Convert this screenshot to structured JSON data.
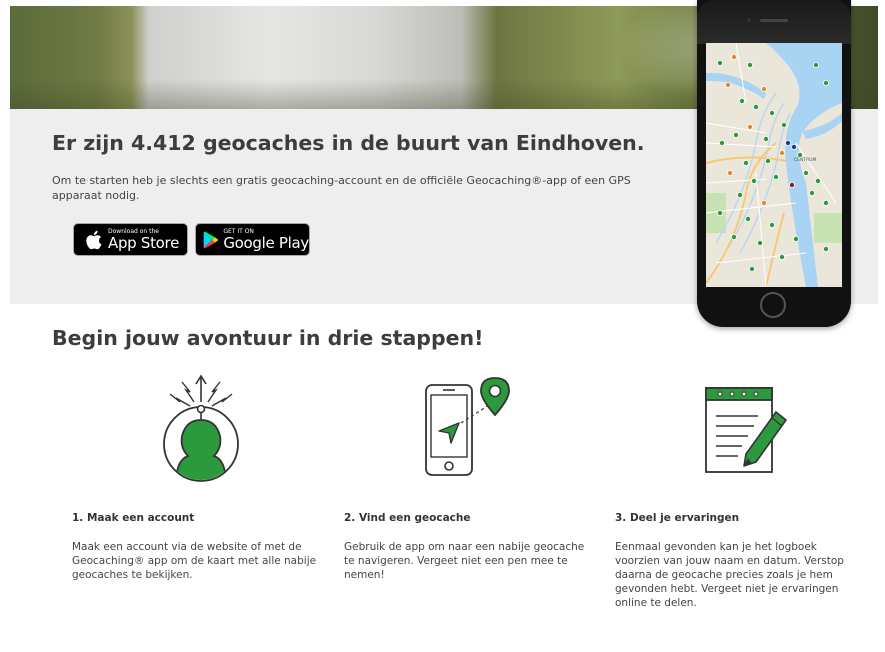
{
  "hero": {
    "title": "Er zijn 4.412 geocaches in de buurt van Eindhoven.",
    "description": "Om te starten heb je slechts een gratis geocaching-account en de officiële Geocaching®-app of een GPS apparaat nodig."
  },
  "badges": {
    "app_store": {
      "small": "Download on the",
      "big": "App Store"
    },
    "google_play": {
      "small": "GET IT ON",
      "big": "Google Play"
    }
  },
  "phone_map": {
    "labels": [
      "CENTRUM"
    ]
  },
  "steps_section": {
    "title": "Begin jouw avontuur in drie stappen!",
    "steps": [
      {
        "title": "1. Maak een account",
        "text": "Maak een account via de website of met de Geocaching® app om de kaart met alle nabije geocaches te bekijken.",
        "icon": "user-signal-icon"
      },
      {
        "title": "2. Vind een geocache",
        "text": "Gebruik de app om naar een nabije geocache te navigeren. Vergeet niet een pen mee te nemen!",
        "icon": "phone-navigation-icon"
      },
      {
        "title": "3. Deel je ervaringen",
        "text": "Eenmaal gevonden kan je het logboek voorzien van jouw naam en datum. Verstop daarna de geocache precies zoals je hem gevonden hebt. Vergeet niet je ervaringen online te delen.",
        "icon": "logbook-pen-icon"
      }
    ]
  },
  "colors": {
    "accent_green": "#2c9a3c",
    "panel_gray": "#eeeeee",
    "text_dark": "#3d3d3d"
  }
}
